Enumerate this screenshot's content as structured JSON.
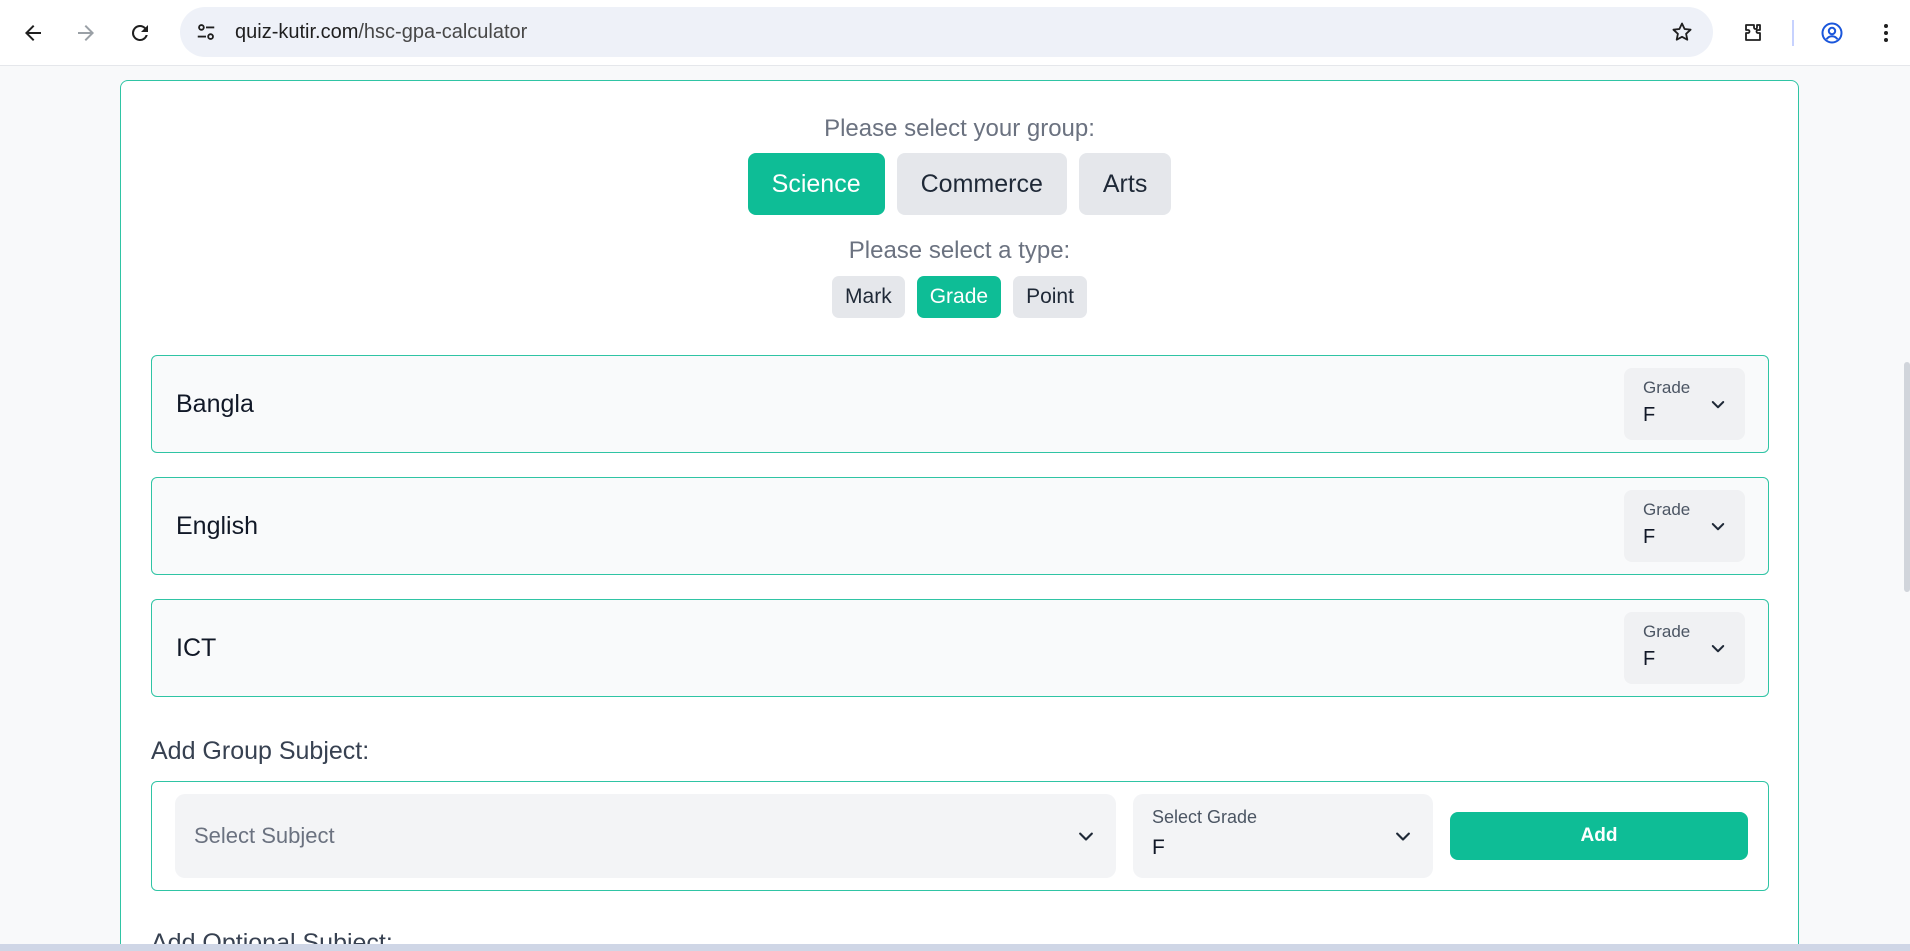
{
  "browser": {
    "url_domain": "quiz-kutir.com",
    "url_path": "/hsc-gpa-calculator",
    "icons": [
      "back-arrow-icon",
      "forward-arrow-icon",
      "reload-icon",
      "site-info-icon",
      "bookmark-star-icon",
      "extensions-icon",
      "profile-icon",
      "kebab-menu-icon"
    ]
  },
  "group": {
    "prompt": "Please select your group:",
    "options": [
      {
        "label": "Science",
        "active": true
      },
      {
        "label": "Commerce",
        "active": false
      },
      {
        "label": "Arts",
        "active": false
      }
    ]
  },
  "type": {
    "prompt": "Please select a type:",
    "options": [
      {
        "label": "Mark",
        "active": false
      },
      {
        "label": "Grade",
        "active": true
      },
      {
        "label": "Point",
        "active": false
      }
    ]
  },
  "subjects": [
    {
      "name": "Bangla",
      "grade_label": "Grade",
      "grade": "F"
    },
    {
      "name": "English",
      "grade_label": "Grade",
      "grade": "F"
    },
    {
      "name": "ICT",
      "grade_label": "Grade",
      "grade": "F"
    }
  ],
  "add_group": {
    "heading": "Add Group Subject:",
    "subject_placeholder": "Select Subject",
    "grade_label": "Select Grade",
    "grade_value": "F",
    "add_label": "Add"
  },
  "add_optional": {
    "heading": "Add Optional Subject:"
  },
  "colors": {
    "accent": "#0ebd96",
    "border": "#2fc4a4",
    "pill_inactive": "#e5e7eb"
  }
}
